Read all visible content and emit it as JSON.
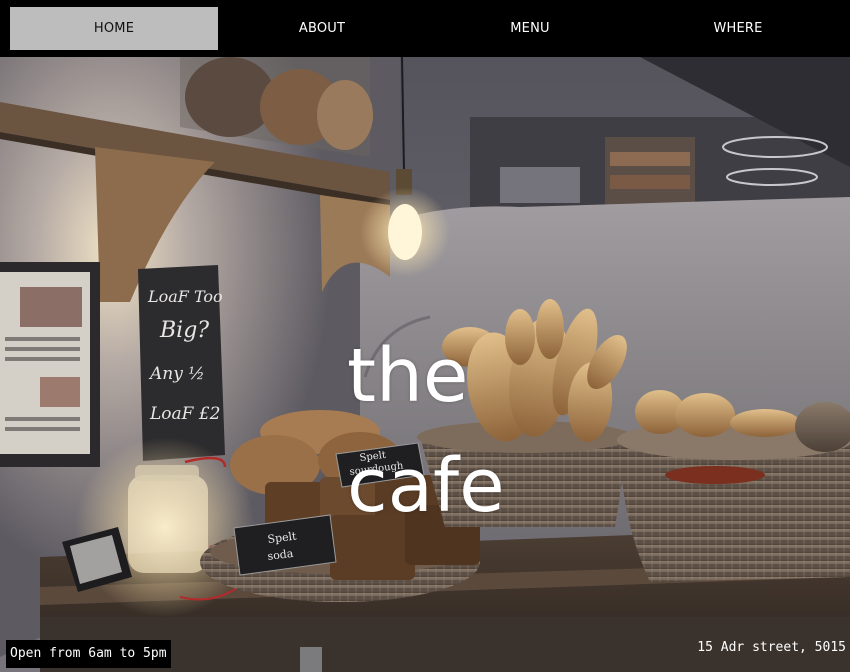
{
  "nav": {
    "items": [
      {
        "label": "HOME",
        "active": true
      },
      {
        "label": "ABOUT",
        "active": false
      },
      {
        "label": "MENU",
        "active": false
      },
      {
        "label": "WHERE",
        "active": false
      }
    ]
  },
  "hero": {
    "title_line1": "the",
    "title_line2": "cafe",
    "chalkboard_text": "LoaF Too Big? Any 1/2 LoaF £2",
    "sign_spelt_sourdough": "Spelt sourdough",
    "sign_spelt_soda": "Spelt soda"
  },
  "footer": {
    "hours": "Open from 6am to 5pm",
    "address": "15 Adr street, 5015"
  },
  "colors": {
    "nav_bg": "#000000",
    "nav_active_bg": "#bdbdbd",
    "text_light": "#ffffff",
    "wall": "#8f8c8f",
    "wood": "#6b5440",
    "bread": "#b88a55"
  }
}
